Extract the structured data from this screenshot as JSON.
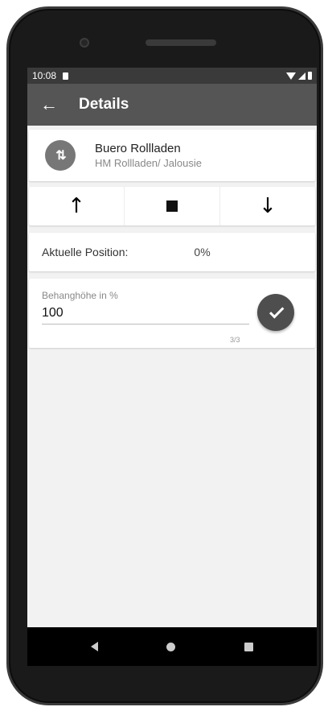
{
  "status_bar": {
    "time": "10:08",
    "icons": [
      "sim-icon",
      "wifi-icon",
      "signal-icon",
      "battery-icon"
    ]
  },
  "app_bar": {
    "back_icon": "arrow-left-icon",
    "back_glyph": "←",
    "title": "Details"
  },
  "device": {
    "avatar_icon": "up-down-arrows-icon",
    "avatar_glyph": "⇅",
    "name": "Buero Rollladen",
    "type": "HM Rollladen/ Jalousie"
  },
  "controls": {
    "up_glyph": "↑",
    "down_glyph": "↓",
    "stop_icon": "stop-icon"
  },
  "position": {
    "label": "Aktuelle Position:",
    "value": "0%"
  },
  "height_field": {
    "label": "Behanghöhe in %",
    "value": "100",
    "counter": "3/3"
  },
  "confirm": {
    "icon": "check-icon"
  },
  "nav_bar": {
    "icons": [
      "back-triangle-icon",
      "home-circle-icon",
      "recents-square-icon"
    ]
  },
  "colors": {
    "app_bar": "#555555",
    "status_bar": "#3a3a3a",
    "background": "#f2f2f2",
    "avatar": "#777777",
    "fab": "#4e4e4e"
  }
}
